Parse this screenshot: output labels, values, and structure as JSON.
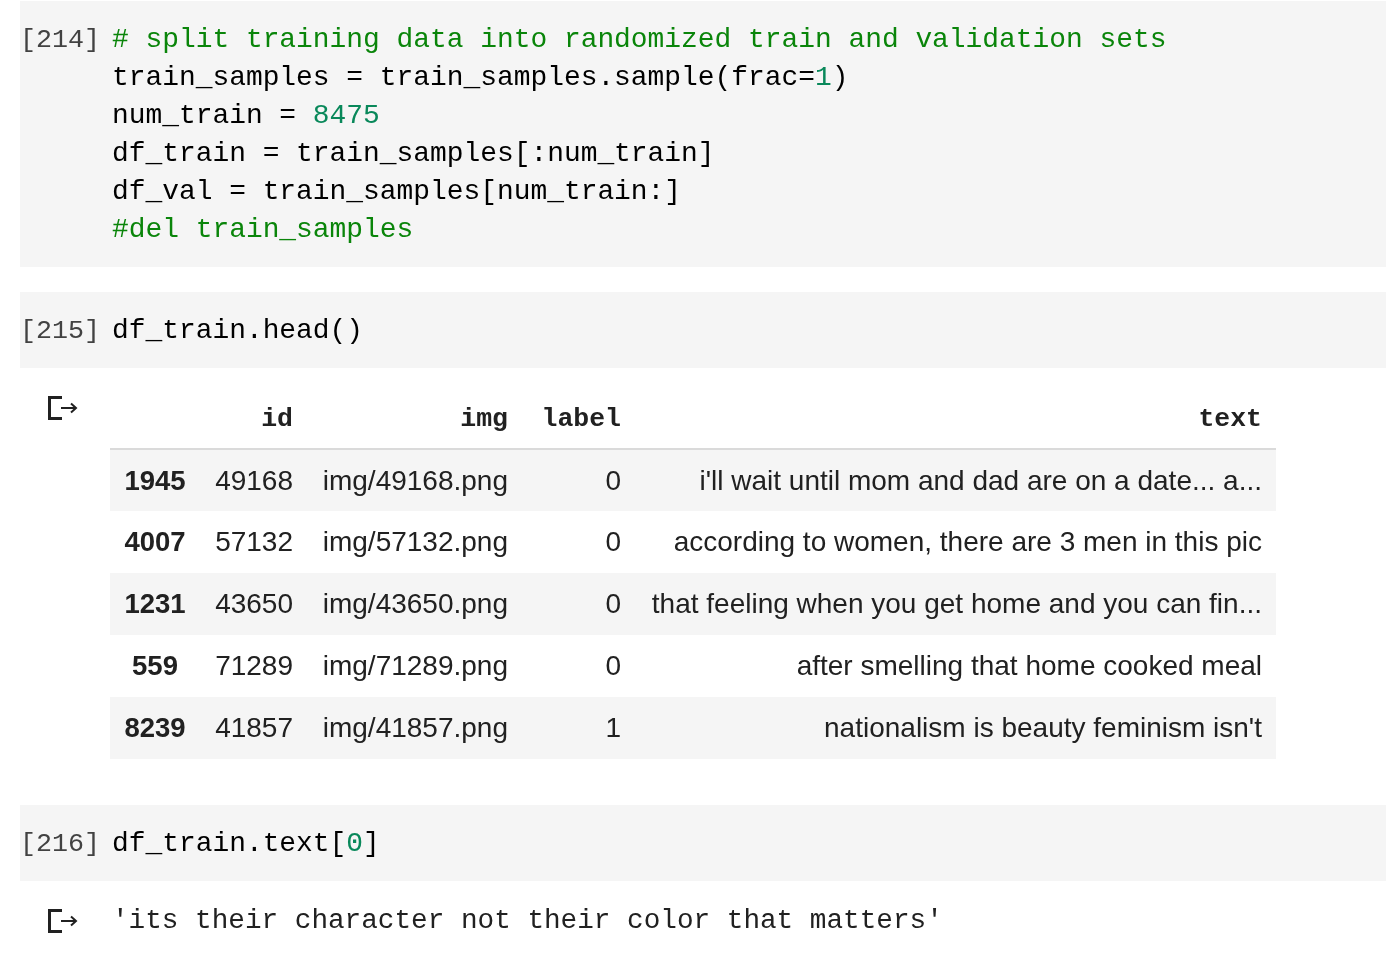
{
  "cells": [
    {
      "prompt": "[214]",
      "code": [
        [
          {
            "kind": "comment",
            "text": "# split training data into randomized train and validation sets"
          }
        ],
        [
          {
            "kind": "plain",
            "text": "train_samples = train_samples.sample(frac="
          },
          {
            "kind": "number",
            "text": "1"
          },
          {
            "kind": "plain",
            "text": ")"
          }
        ],
        [
          {
            "kind": "plain",
            "text": "num_train = "
          },
          {
            "kind": "number",
            "text": "8475"
          }
        ],
        [
          {
            "kind": "plain",
            "text": "df_train = train_samples[:num_train]"
          }
        ],
        [
          {
            "kind": "plain",
            "text": "df_val = train_samples[num_train:]"
          }
        ],
        [
          {
            "kind": "comment",
            "text": "#del train_samples"
          }
        ]
      ]
    },
    {
      "prompt": "[215]",
      "code": [
        [
          {
            "kind": "plain",
            "text": "df_train.head()"
          }
        ]
      ],
      "output": {
        "kind": "table",
        "columns": [
          "id",
          "img",
          "label",
          "text"
        ],
        "rows": [
          {
            "index": "1945",
            "values": [
              "49168",
              "img/49168.png",
              "0",
              "i'll wait until mom and dad are on a date... a..."
            ]
          },
          {
            "index": "4007",
            "values": [
              "57132",
              "img/57132.png",
              "0",
              "according to women, there are 3 men in this pic"
            ]
          },
          {
            "index": "1231",
            "values": [
              "43650",
              "img/43650.png",
              "0",
              "that feeling when you get home and you can fin..."
            ]
          },
          {
            "index": "559",
            "values": [
              "71289",
              "img/71289.png",
              "0",
              "after smelling that home cooked meal"
            ]
          },
          {
            "index": "8239",
            "values": [
              "41857",
              "img/41857.png",
              "1",
              "nationalism is beauty feminism isn't"
            ]
          }
        ]
      }
    },
    {
      "prompt": "[216]",
      "code": [
        [
          {
            "kind": "plain",
            "text": "df_train.text["
          },
          {
            "kind": "number",
            "text": "0"
          },
          {
            "kind": "plain",
            "text": "]"
          }
        ]
      ],
      "output": {
        "kind": "text",
        "text": "'its their character not their color that matters'"
      }
    }
  ]
}
